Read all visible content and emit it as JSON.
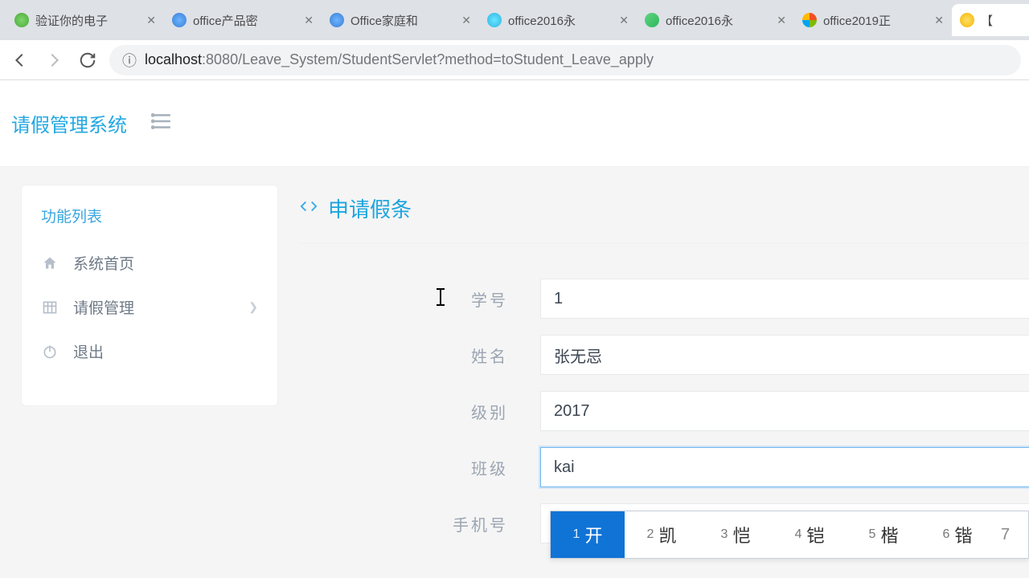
{
  "browser": {
    "tabs": [
      {
        "title": "验证你的电子",
        "fav": "fav-green"
      },
      {
        "title": "office产品密",
        "fav": "fav-blue"
      },
      {
        "title": "Office家庭和",
        "fav": "fav-blue"
      },
      {
        "title": "office2016永",
        "fav": "fav-cyan"
      },
      {
        "title": "office2016永",
        "fav": "fav-green2"
      },
      {
        "title": "office2019正",
        "fav": "fav-ms"
      },
      {
        "title": "【",
        "fav": "fav-yellow"
      }
    ],
    "url_host": "localhost",
    "url_path": ":8080/Leave_System/StudentServlet?method=toStudent_Leave_apply"
  },
  "header": {
    "app_title": "请假管理系统"
  },
  "sidebar": {
    "title": "功能列表",
    "items": [
      {
        "label": "系统首页"
      },
      {
        "label": "请假管理"
      },
      {
        "label": "退出"
      }
    ]
  },
  "section": {
    "title": "申请假条"
  },
  "form": {
    "student_no": {
      "label": "学号",
      "value": "1"
    },
    "name": {
      "label": "姓名",
      "value": "张无忌"
    },
    "grade": {
      "label": "级别",
      "value": "2017"
    },
    "klass": {
      "label": "班级",
      "value": "kai"
    },
    "phone": {
      "label": "手机号",
      "value": ""
    }
  },
  "ime": {
    "candidates": [
      {
        "num": "1",
        "char": "开"
      },
      {
        "num": "2",
        "char": "凯"
      },
      {
        "num": "3",
        "char": "恺"
      },
      {
        "num": "4",
        "char": "铠"
      },
      {
        "num": "5",
        "char": "楷"
      },
      {
        "num": "6",
        "char": "锴"
      }
    ],
    "more": "7"
  }
}
